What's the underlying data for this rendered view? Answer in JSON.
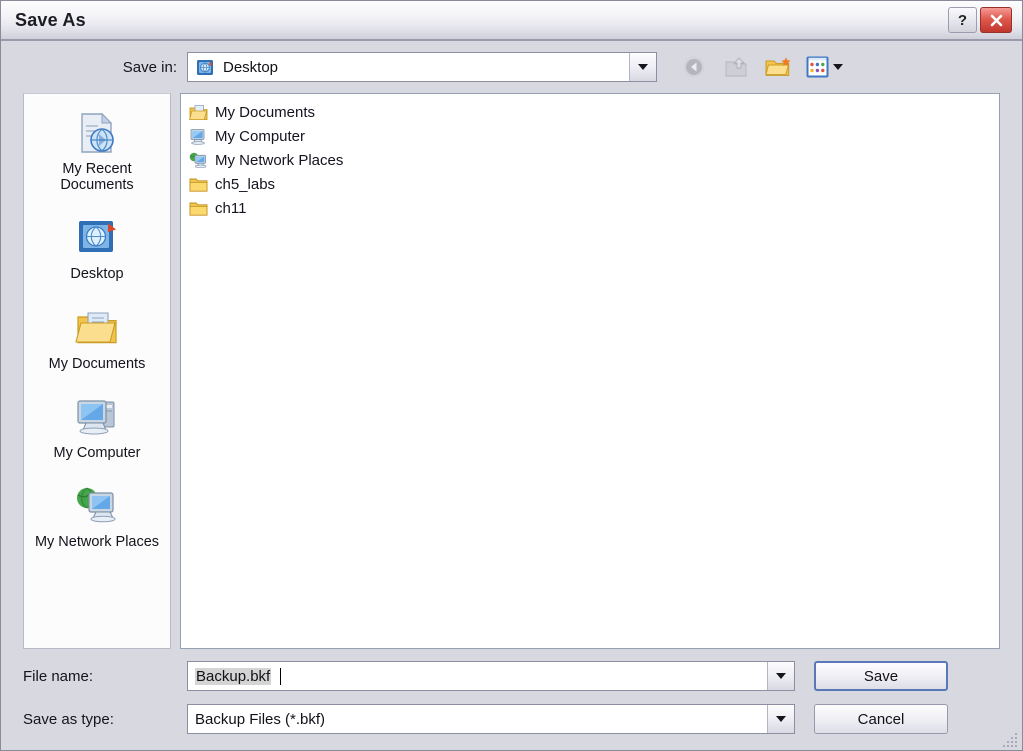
{
  "window": {
    "title": "Save As",
    "help_button": "?",
    "close_button": "✕"
  },
  "toolbar": {
    "savein_label": "Save in:",
    "savein_value": "Desktop",
    "back_icon": "back-arrow-icon",
    "up_icon": "up-one-level-icon",
    "newfolder_icon": "new-folder-icon",
    "views_icon": "views-icon"
  },
  "places": {
    "items": [
      {
        "label": "My Recent Documents",
        "icon": "recent-documents-icon"
      },
      {
        "label": "Desktop",
        "icon": "desktop-icon"
      },
      {
        "label": "My Documents",
        "icon": "my-documents-icon"
      },
      {
        "label": "My Computer",
        "icon": "my-computer-icon"
      },
      {
        "label": "My Network Places",
        "icon": "my-network-places-icon"
      }
    ]
  },
  "file_list": {
    "items": [
      {
        "name": "My Documents",
        "icon": "my-documents-folder-icon"
      },
      {
        "name": "My Computer",
        "icon": "my-computer-icon"
      },
      {
        "name": "My Network Places",
        "icon": "my-network-places-icon"
      },
      {
        "name": "ch5_labs",
        "icon": "folder-icon"
      },
      {
        "name": "ch11",
        "icon": "folder-icon"
      }
    ]
  },
  "fields": {
    "filename_label": "File name:",
    "filename_value": "Backup.bkf",
    "filetype_label": "Save as type:",
    "filetype_value": "Backup Files (*.bkf)"
  },
  "buttons": {
    "save": "Save",
    "cancel": "Cancel"
  },
  "colors": {
    "dialog_bg": "#d8d8e0",
    "close_red": "#c0362c",
    "default_button_focus": "#5a77b8",
    "folder_yellow": "#f5c349",
    "list_bg": "#ffffff"
  }
}
